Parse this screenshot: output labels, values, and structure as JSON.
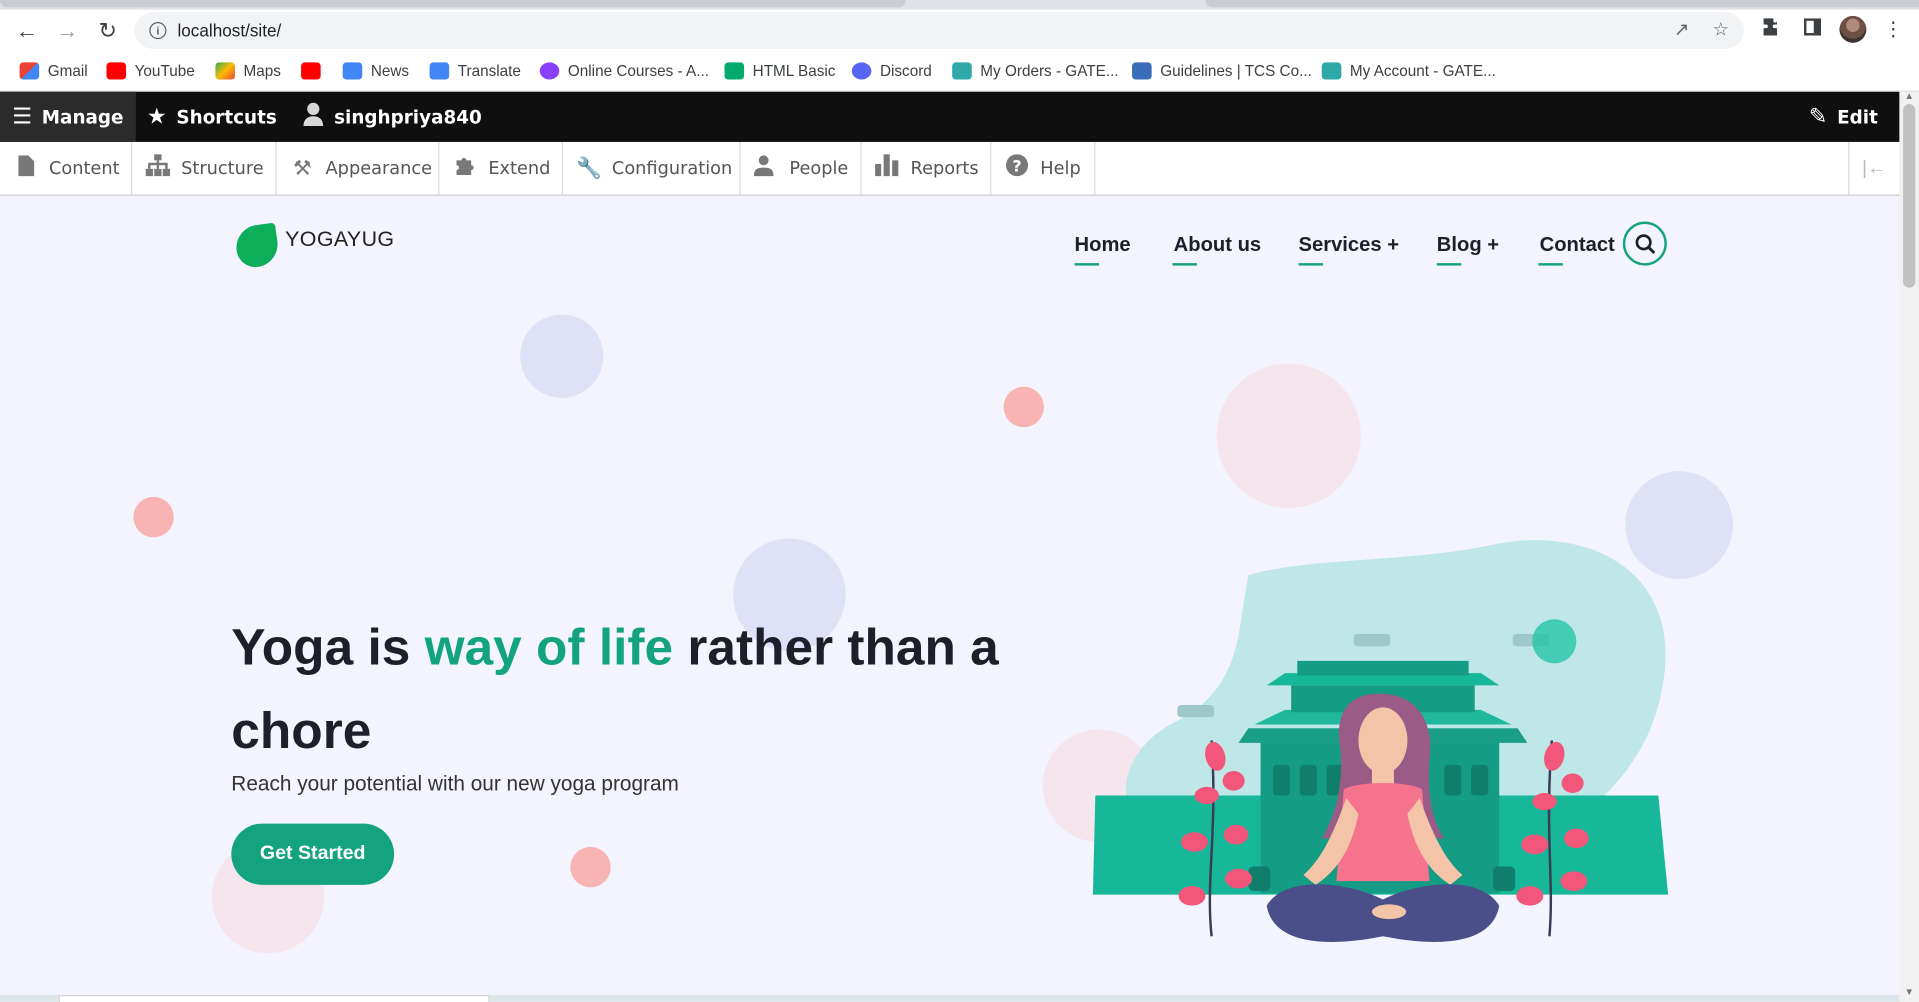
{
  "browser": {
    "url": "localhost/site/",
    "bookmarks": [
      {
        "label": "Gmail",
        "color": "#ea4335"
      },
      {
        "label": "YouTube",
        "color": "#ff0000"
      },
      {
        "label": "Maps",
        "color": "#34a853"
      },
      {
        "label": "",
        "color": "#ff0000"
      },
      {
        "label": "News",
        "color": "#4285f4"
      },
      {
        "label": "Translate",
        "color": "#4285f4"
      },
      {
        "label": "Online Courses - A...",
        "color": "#8a3ffc"
      },
      {
        "label": "HTML Basic",
        "color": "#04aa6d"
      },
      {
        "label": "Discord",
        "color": "#5865f2"
      },
      {
        "label": "My Orders - GATE...",
        "color": "#2fa8a8"
      },
      {
        "label": "Guidelines | TCS Co...",
        "color": "#3b6cb7"
      },
      {
        "label": "My Account - GATE...",
        "color": "#2fa8a8"
      }
    ]
  },
  "admin": {
    "manage": "Manage",
    "shortcuts": "Shortcuts",
    "user": "singhpriya840",
    "edit": "Edit",
    "tray": [
      "Content",
      "Structure",
      "Appearance",
      "Extend",
      "Configuration",
      "People",
      "Reports",
      "Help"
    ]
  },
  "site": {
    "logo": "YOGAYUG",
    "nav": [
      "Home",
      "About us",
      "Services +",
      "Blog +",
      "Contact"
    ],
    "hero": {
      "title_a": "Yoga is ",
      "title_highlight": "way of life",
      "title_b": " rather than a chore",
      "subtitle": "Reach your potential with our new yoga program",
      "cta": "Get Started"
    },
    "colors": {
      "accent": "#14a37f",
      "dark": "#1d1f2b",
      "background": "#f3f4fe"
    }
  }
}
